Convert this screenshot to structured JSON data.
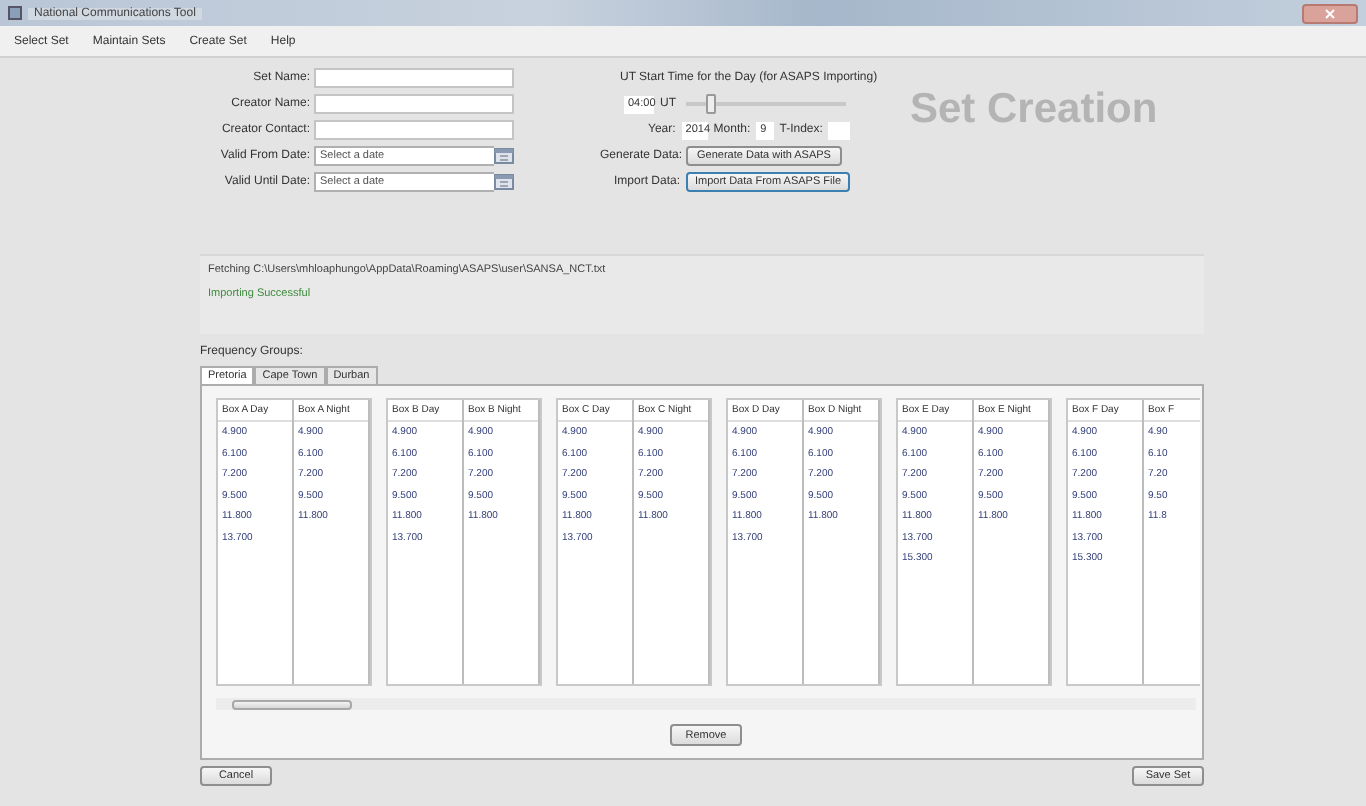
{
  "window": {
    "title": "National Communications Tool"
  },
  "menu": [
    "Select Set",
    "Maintain Sets",
    "Create Set",
    "Help"
  ],
  "form": [
    {
      "kind": "text",
      "label": "Set Name:"
    },
    {
      "kind": "text",
      "label": "Creator Name:"
    },
    {
      "kind": "text",
      "label": "Creator Contact:"
    },
    {
      "kind": "date",
      "label": "Valid From Date:",
      "placeholder": "Select a date"
    },
    {
      "kind": "date",
      "label": "Valid Until Date:",
      "placeholder": "Select a date"
    }
  ],
  "asaps": {
    "heading": "UT Start Time for the Day (for ASAPS Importing)",
    "time": "04:00",
    "unit": "UT",
    "level": 0.15,
    "year_label": "Year:",
    "year": "2014",
    "month_label": "Month:",
    "month": "9",
    "tindex_label": "T-Index:",
    "generate_label": "Generate Data:",
    "generate_button": "Generate Data with ASAPS",
    "import_label": "Import Data:",
    "import_button": "Import Data From ASAPS File"
  },
  "page_title": "Set Creation",
  "log": [
    {
      "kind": "info",
      "text": "Fetching C:\\Users\\mhloaphungo\\AppData\\Roaming\\ASAPS\\user\\SANSA_NCT.txt"
    },
    {
      "kind": "success",
      "text": "Importing Successful"
    }
  ],
  "frequency_groups": {
    "label": "Frequency Groups:",
    "tabs": [
      {
        "label": "Pretoria",
        "selected": true
      },
      {
        "label": "Cape Town",
        "selected": false
      },
      {
        "label": "Durban",
        "selected": false
      }
    ],
    "boxes": [
      {
        "day": {
          "title": "Box A Day",
          "values": [
            "4.900",
            "6.100",
            "7.200",
            "9.500",
            "11.800",
            "13.700"
          ]
        },
        "night": {
          "title": "Box A Night",
          "values": [
            "4.900",
            "6.100",
            "7.200",
            "9.500",
            "11.800"
          ]
        }
      },
      {
        "day": {
          "title": "Box B Day",
          "values": [
            "4.900",
            "6.100",
            "7.200",
            "9.500",
            "11.800",
            "13.700"
          ]
        },
        "night": {
          "title": "Box B Night",
          "values": [
            "4.900",
            "6.100",
            "7.200",
            "9.500",
            "11.800"
          ]
        }
      },
      {
        "day": {
          "title": "Box C Day",
          "values": [
            "4.900",
            "6.100",
            "7.200",
            "9.500",
            "11.800",
            "13.700"
          ]
        },
        "night": {
          "title": "Box C Night",
          "values": [
            "4.900",
            "6.100",
            "7.200",
            "9.500",
            "11.800"
          ]
        }
      },
      {
        "day": {
          "title": "Box D Day",
          "values": [
            "4.900",
            "6.100",
            "7.200",
            "9.500",
            "11.800",
            "13.700"
          ]
        },
        "night": {
          "title": "Box D Night",
          "values": [
            "4.900",
            "6.100",
            "7.200",
            "9.500",
            "11.800"
          ]
        }
      },
      {
        "day": {
          "title": "Box E Day",
          "values": [
            "4.900",
            "6.100",
            "7.200",
            "9.500",
            "11.800",
            "13.700",
            "15.300"
          ]
        },
        "night": {
          "title": "Box E Night",
          "values": [
            "4.900",
            "6.100",
            "7.200",
            "9.500",
            "11.800"
          ]
        }
      },
      {
        "day": {
          "title": "Box F Day",
          "values": [
            "4.900",
            "6.100",
            "7.200",
            "9.500",
            "11.800",
            "13.700",
            "15.300"
          ]
        },
        "night": {
          "title": "Box F",
          "values": [
            "4.90",
            "6.10",
            "7.20",
            "9.50",
            "11.8"
          ]
        }
      }
    ],
    "remove_button": "Remove"
  },
  "buttons": {
    "cancel": "Cancel",
    "save": "Save Set"
  }
}
